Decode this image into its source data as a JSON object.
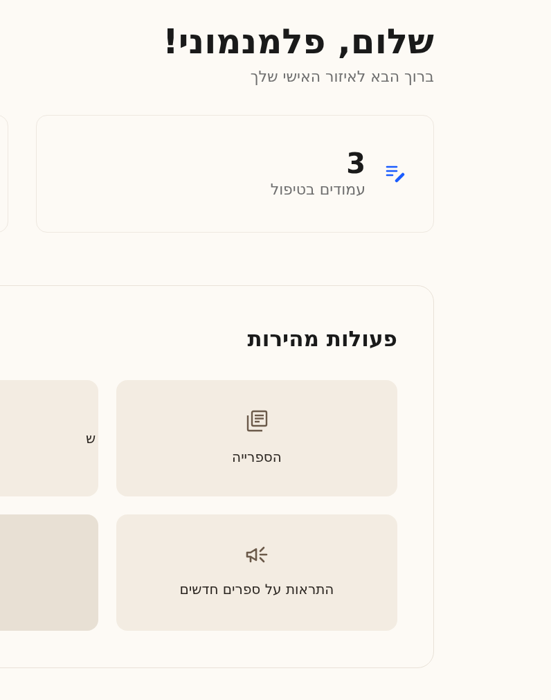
{
  "greeting": {
    "title": "שלום, פלמנמוני!",
    "subtitle": "ברוך הבא לאיזור האישי שלך"
  },
  "stats": [
    {
      "kind": "pages",
      "value": "3",
      "label": "עמודים בטיפול"
    },
    {
      "kind": "cut"
    }
  ],
  "quick_actions": {
    "title": "פעולות מהירות",
    "items": [
      {
        "kind": "library",
        "label": "הספרייה",
        "highlighted": false
      },
      {
        "kind": "cut",
        "label": "ש",
        "highlighted": false
      },
      {
        "kind": "alerts",
        "label": "התראות על ספרים חדשים",
        "highlighted": false
      },
      {
        "kind": "cut",
        "highlighted": true
      }
    ]
  }
}
